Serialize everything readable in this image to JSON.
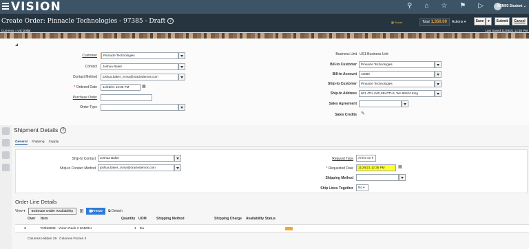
{
  "app": {
    "logo": "VISION",
    "user": "SCM03 Student"
  },
  "title_bar": {
    "title": "Create Order: Pinnacle Technologies - 97385 - Draft",
    "social": "Social",
    "total_label": "Total",
    "total_value": "1,350.00",
    "actions": "Actions",
    "save": "Save",
    "submit": "Submit",
    "cancel": "Cancel",
    "currency": "Currency = US Dollar",
    "last_saved": "Last Saved 11/26/21 12:35 PM"
  },
  "header": {
    "customer_label": "Customer",
    "customer": "Pinnacle Technologies",
    "contact_label": "Contact",
    "contact": "Joshua Baker",
    "contact_method_label": "Contact Method",
    "contact_method": "joshua.baker_zvma@oracledemos.com",
    "ordered_date_label": "Ordered Date",
    "ordered_date": "11/26/21 12:35 PM",
    "purchase_order_label": "Purchase Order",
    "purchase_order": "",
    "order_type_label": "Order Type",
    "order_type": "",
    "business_unit_label": "Business Unit",
    "business_unit": "US1 Business Unit",
    "bill_to_customer_label": "Bill-to Customer",
    "bill_to_customer": "Pinnacle Technologies",
    "bill_to_account_label": "Bill-to Account",
    "bill_to_account": "10080",
    "ship_to_customer_label": "Ship-to Customer",
    "ship_to_customer": "Pinnacle Technologies",
    "ship_to_address_label": "Ship-to Address",
    "ship_to_address": "601 4TH AVE,SEATTLE, WA 98104 King",
    "sales_agreement_label": "Sales Agreement",
    "sales_agreement": "",
    "sales_credits_label": "Sales Credits"
  },
  "shipment": {
    "title": "Shipment Details",
    "tabs": [
      "General",
      "Shipping",
      "Supply"
    ],
    "ship_to_contact_label": "Ship-to Contact",
    "ship_to_contact": "Joshua Baker",
    "ship_to_contact_method_label": "Ship-to Contact Method",
    "ship_to_contact_method": "joshua.baker_zvma@oracledemos.com",
    "request_type_label": "Request Type",
    "request_type": "Arrive on",
    "requested_date_label": "Requested Date",
    "requested_date": "11/26/21 12:35 PM",
    "shipping_method_label": "Shipping Method",
    "shipping_method": "",
    "ship_lines_together_label": "Ship Lines Together",
    "ship_lines_together": "No"
  },
  "order_lines": {
    "title": "Order Line Details",
    "view": "View",
    "estimate_button": "Estimate Order Availability",
    "freeze": "Freeze",
    "detach": "Detach",
    "columns": [
      "Over",
      "Item",
      "Quantity",
      "UOM",
      "Shipping Method",
      "Shipping Charge",
      "Availability Status"
    ],
    "rows": [
      {
        "num": "1",
        "item": "CM53035 - Vision Rack II 1042RU",
        "quantity": "1",
        "uom": "Ea"
      }
    ],
    "columns_hidden": "Columns Hidden  29",
    "columns_frozen": "Columns Frozen  3"
  },
  "colors": {
    "topbar": "#3d5467",
    "titlebar": "#26343f",
    "accent": "#f0a42c",
    "highlight": "#ffff33",
    "freeze": "#2f7ad5"
  }
}
